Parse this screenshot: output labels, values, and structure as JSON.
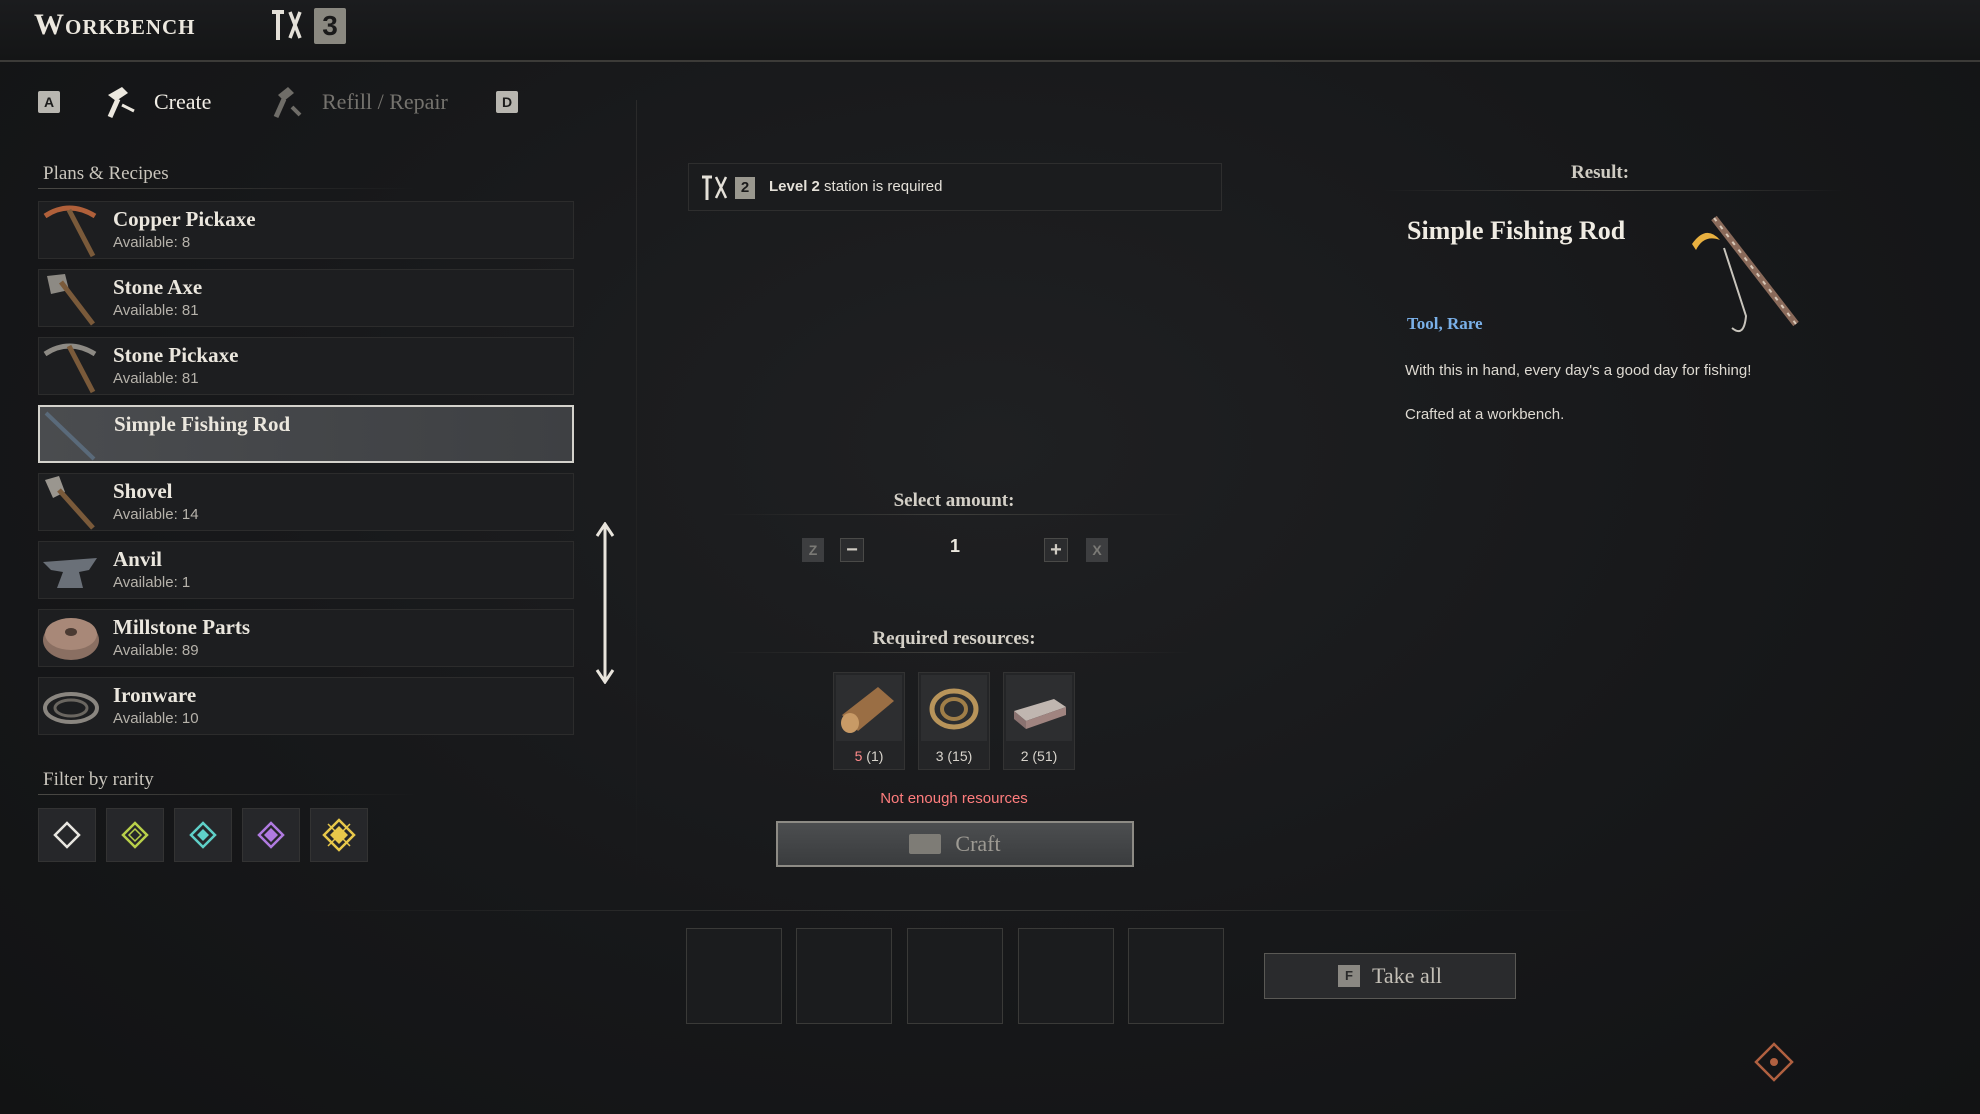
{
  "window": {
    "title": "Workbench",
    "workbench_level": "3"
  },
  "tabs": {
    "prev_key": "A",
    "next_key": "D",
    "items": [
      {
        "label": "Create",
        "icon": "hammer-icon",
        "active": true
      },
      {
        "label": "Refill / Repair",
        "icon": "wrench-icon",
        "active": false
      }
    ]
  },
  "sidebar": {
    "section_title": "Plans & Recipes",
    "recipes": [
      {
        "name": "Copper Pickaxe",
        "available": "Available: 8",
        "icon": "pickaxe-icon"
      },
      {
        "name": "Stone Axe",
        "available": "Available: 81",
        "icon": "axe-icon"
      },
      {
        "name": "Stone Pickaxe",
        "available": "Available: 81",
        "icon": "pickaxe-icon"
      },
      {
        "name": "Simple Fishing Rod",
        "available": "",
        "icon": "fishing-rod-icon",
        "selected": true
      },
      {
        "name": "Shovel",
        "available": "Available: 14",
        "icon": "shovel-icon"
      },
      {
        "name": "Anvil",
        "available": "Available: 1",
        "icon": "anvil-icon"
      },
      {
        "name": "Millstone Parts",
        "available": "Available: 89",
        "icon": "millstone-icon"
      },
      {
        "name": "Ironware",
        "available": "Available: 10",
        "icon": "ironware-icon"
      }
    ],
    "filter_title": "Filter by rarity",
    "filters": [
      {
        "rarity": "common",
        "color": "#e8e6e0"
      },
      {
        "rarity": "uncommon",
        "color": "#b8d04a"
      },
      {
        "rarity": "rare",
        "color": "#5fd0c8"
      },
      {
        "rarity": "epic",
        "color": "#b07ae0"
      },
      {
        "rarity": "legendary",
        "color": "#e8c84a"
      }
    ]
  },
  "station": {
    "level_label": "2",
    "text_bold": "Level 2",
    "text_rest": " station is required"
  },
  "amount": {
    "label": "Select amount:",
    "value": "1",
    "decrease_key": "Z",
    "increase_key": "X",
    "minus": "−",
    "plus": "+"
  },
  "resources": {
    "label": "Required resources:",
    "items": [
      {
        "icon": "wood-log-icon",
        "need": "5",
        "have": " (1)",
        "insufficient": true
      },
      {
        "icon": "rope-icon",
        "need": "3",
        "have": " (15)",
        "insufficient": false
      },
      {
        "icon": "iron-ingot-icon",
        "need": "2",
        "have": " (51)",
        "insufficient": false
      }
    ],
    "warning": "Not enough resources"
  },
  "craft": {
    "label": "Craft"
  },
  "take_all": {
    "key": "F",
    "label": "Take all"
  },
  "result": {
    "heading": "Result:",
    "name": "Simple Fishing Rod",
    "tags": "Tool, Rare",
    "description": "With this in hand, every day's a good day for fishing!",
    "crafted_at": "Crafted at a workbench.",
    "tag_color": "#7ab0e8"
  },
  "colors": {
    "warning": "#ff7d7d",
    "insufficient": "#ff8a8a"
  }
}
